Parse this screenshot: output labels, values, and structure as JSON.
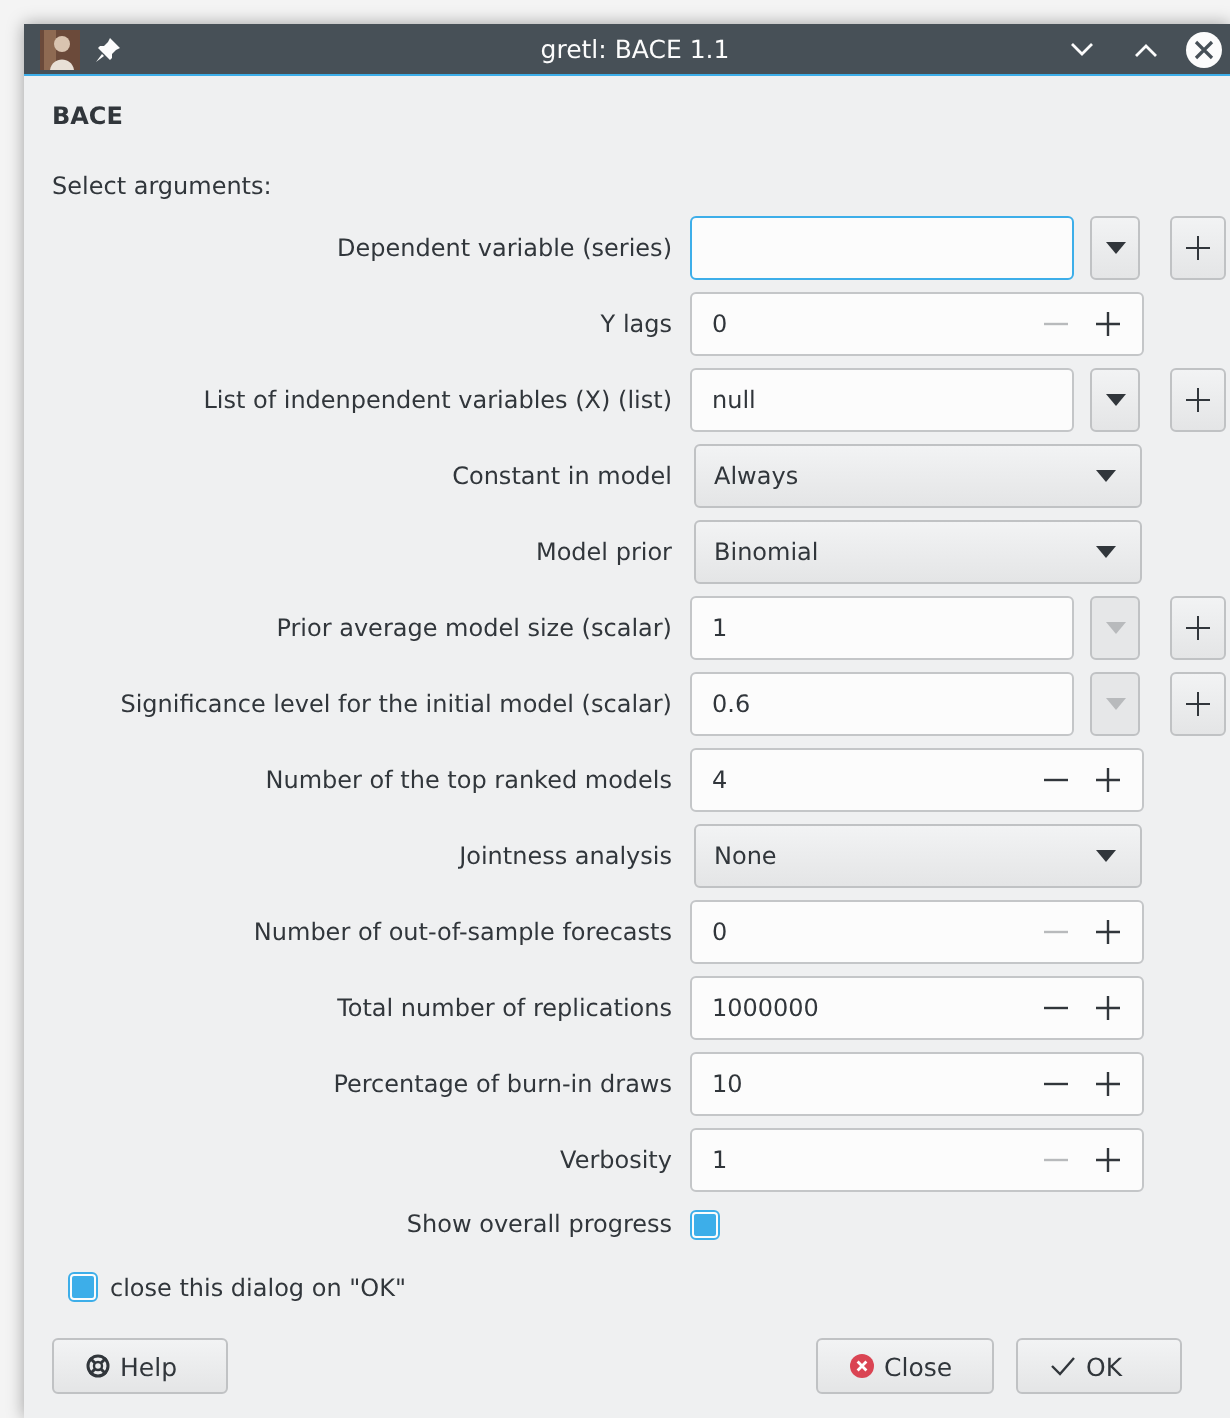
{
  "window": {
    "title": "gretl: BACE 1.1"
  },
  "heading": "BACE",
  "intro": "Select arguments:",
  "rows": [
    {
      "kind": "entry",
      "label": "Dependent variable (series)",
      "focused": true,
      "menu_disabled": false
    },
    {
      "kind": "spin",
      "label": "Y lags",
      "value": "0",
      "minus_disabled": true
    },
    {
      "kind": "entry",
      "label": "List of indenpendent variables (X) (list)",
      "value": "null",
      "focused": false,
      "menu_disabled": false
    },
    {
      "kind": "combo",
      "label": "Constant in model",
      "value": "Always"
    },
    {
      "kind": "combo",
      "label": "Model prior",
      "value": "Binomial"
    },
    {
      "kind": "entry",
      "label": "Prior average model size (scalar)",
      "value": "1",
      "focused": false,
      "menu_disabled": true
    },
    {
      "kind": "entry",
      "label": "Significance level for the initial model (scalar)",
      "value": "0.6",
      "focused": false,
      "menu_disabled": true
    },
    {
      "kind": "spin",
      "label": "Number of the top ranked models",
      "value": "4",
      "minus_disabled": false
    },
    {
      "kind": "combo",
      "label": "Jointness analysis",
      "value": "None"
    },
    {
      "kind": "spin",
      "label": "Number of out-of-sample forecasts",
      "value": "0",
      "minus_disabled": true
    },
    {
      "kind": "spin",
      "label": "Total number of replications",
      "value": "1000000",
      "minus_disabled": false
    },
    {
      "kind": "spin",
      "label": "Percentage of burn-in draws",
      "value": "10",
      "minus_disabled": false
    },
    {
      "kind": "spin",
      "label": "Verbosity",
      "value": "1",
      "minus_disabled": true
    },
    {
      "kind": "check",
      "label": "Show overall progress",
      "checked": true
    }
  ],
  "close_on_ok": {
    "label": "close this dialog on \"OK\"",
    "checked": true
  },
  "buttons": [
    {
      "kind": "help",
      "label": "Help"
    },
    {
      "kind": "close",
      "label": "Close"
    },
    {
      "kind": "ok",
      "label": "OK"
    }
  ]
}
